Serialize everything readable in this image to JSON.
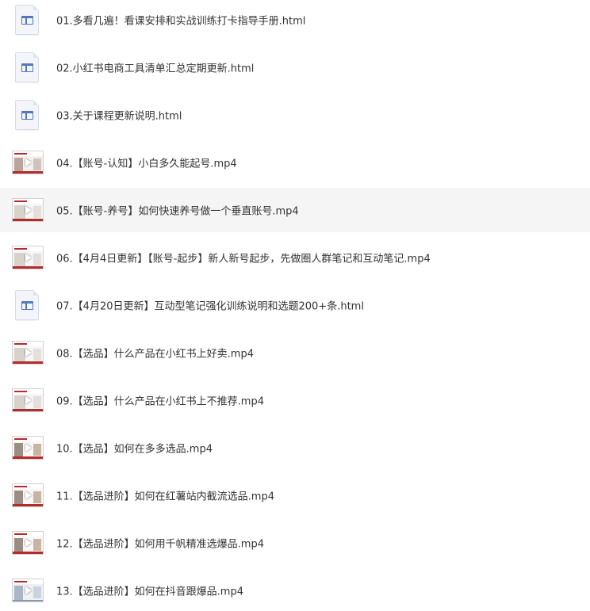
{
  "files": [
    {
      "name": "01.多看几遍！看课安排和实战训练打卡指导手册.html",
      "type": "html",
      "icon": "html-file-icon"
    },
    {
      "name": "02.小红书电商工具清单汇总定期更新.html",
      "type": "html",
      "icon": "html-file-icon"
    },
    {
      "name": "03.关于课程更新说明.html",
      "type": "html",
      "icon": "html-file-icon"
    },
    {
      "name": "04.【账号-认知】小白多久能起号.mp4",
      "type": "video",
      "icon": "video-thumbnail"
    },
    {
      "name": "05.【账号-养号】如何快速养号做一个垂直账号.mp4",
      "type": "video",
      "icon": "video-thumbnail",
      "highlighted": true
    },
    {
      "name": "06.【4月4日更新】【账号-起步】新人新号起步，先做圈人群笔记和互动笔记.mp4",
      "type": "video",
      "icon": "video-thumbnail"
    },
    {
      "name": "07.【4月20日更新】互动型笔记强化训练说明和选题200+条.html",
      "type": "html",
      "icon": "html-file-icon"
    },
    {
      "name": "08.【选品】什么产品在小红书上好卖.mp4",
      "type": "video",
      "icon": "video-thumbnail"
    },
    {
      "name": "09.【选品】什么产品在小红书上不推荐.mp4",
      "type": "video",
      "icon": "video-thumbnail"
    },
    {
      "name": "10.【选品】如何在多多选品.mp4",
      "type": "video",
      "icon": "video-thumbnail"
    },
    {
      "name": "11.【选品进阶】如何在红薯站内截流选品.mp4",
      "type": "video",
      "icon": "video-thumbnail"
    },
    {
      "name": "12.【选品进阶】如何用千帆精准选爆品.mp4",
      "type": "video",
      "icon": "video-thumbnail"
    },
    {
      "name": "13.【选品进阶】如何在抖音跟爆品.mp4",
      "type": "video",
      "icon": "video-thumbnail"
    }
  ],
  "colors": {
    "text": "#333333",
    "hover_background": "#f5f5f5",
    "html_icon_accent": "#5577bb",
    "thumbnail_accent": "#b52a2a"
  }
}
